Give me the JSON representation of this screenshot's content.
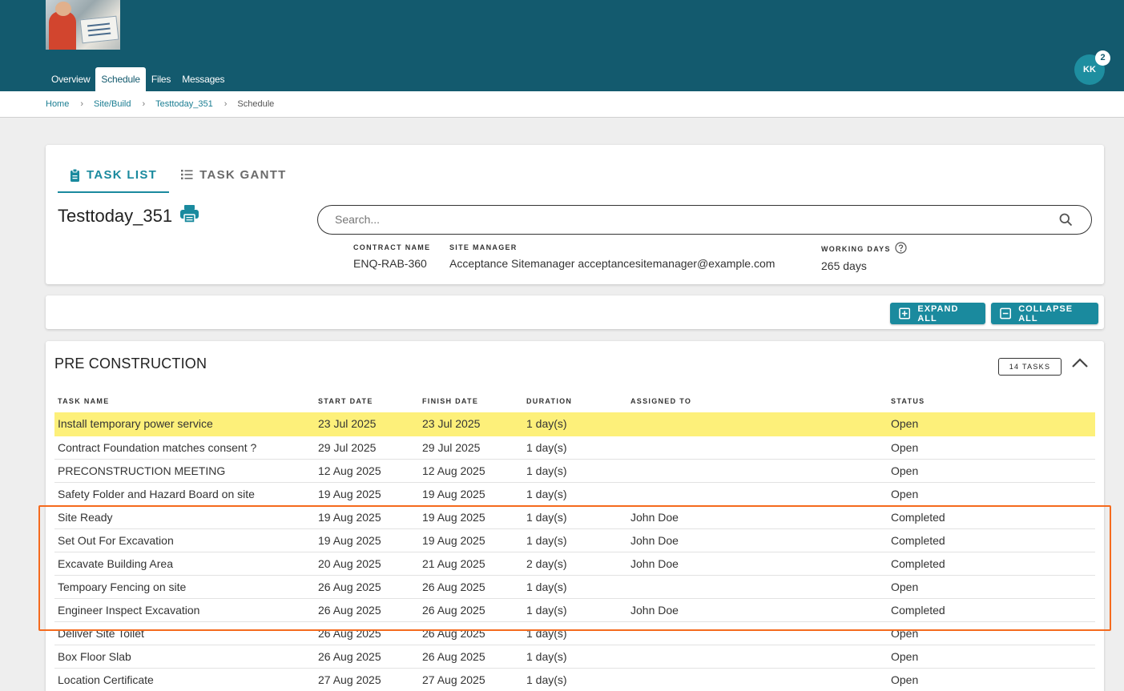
{
  "nav": {
    "items": [
      {
        "label": "Overview",
        "active": false
      },
      {
        "label": "Schedule",
        "active": true
      },
      {
        "label": "Files",
        "active": false
      },
      {
        "label": "Messages",
        "active": false
      }
    ]
  },
  "user": {
    "initials": "KK",
    "notification_count": "2"
  },
  "breadcrumb": {
    "items": [
      "Home",
      "Site/Build",
      "Testtoday_351",
      "Schedule"
    ],
    "separator": "›"
  },
  "tabs": [
    {
      "label": "TASK LIST",
      "icon": "clipboard-icon",
      "active": true
    },
    {
      "label": "TASK GANTT",
      "icon": "list-icon",
      "active": false
    }
  ],
  "project": {
    "title": "Testtoday_351"
  },
  "search": {
    "placeholder": "Search...",
    "value": ""
  },
  "meta": {
    "contract_label": "CONTRACT NAME",
    "contract_value": "ENQ-RAB-360",
    "manager_label": "SITE MANAGER",
    "manager_value": "Acceptance Sitemanager acceptancesitemanager@example.com",
    "days_label": "WORKING DAYS",
    "days_value": "265 days"
  },
  "actions": {
    "expand_all": "EXPAND ALL",
    "collapse_all": "COLLAPSE ALL"
  },
  "section": {
    "title": "PRE CONSTRUCTION",
    "tasks_badge": "14 TASKS",
    "columns": [
      "TASK NAME",
      "START DATE",
      "FINISH DATE",
      "DURATION",
      "ASSIGNED TO",
      "STATUS"
    ],
    "rows": [
      {
        "name": "Install temporary power service",
        "start": "23 Jul 2025",
        "finish": "23 Jul 2025",
        "duration": "1 day(s)",
        "assigned": "",
        "status": "Open"
      },
      {
        "name": "Contract Foundation matches consent ?",
        "start": "29 Jul 2025",
        "finish": "29 Jul 2025",
        "duration": "1 day(s)",
        "assigned": "",
        "status": "Open"
      },
      {
        "name": "PRECONSTRUCTION MEETING",
        "start": "12 Aug 2025",
        "finish": "12 Aug 2025",
        "duration": "1 day(s)",
        "assigned": "",
        "status": "Open"
      },
      {
        "name": "Safety Folder and Hazard Board on site",
        "start": "19 Aug 2025",
        "finish": "19 Aug 2025",
        "duration": "1 day(s)",
        "assigned": "",
        "status": "Open"
      },
      {
        "name": "Site Ready",
        "start": "19 Aug 2025",
        "finish": "19 Aug 2025",
        "duration": "1 day(s)",
        "assigned": "John Doe",
        "status": "Completed"
      },
      {
        "name": "Set Out For Excavation",
        "start": "19 Aug 2025",
        "finish": "19 Aug 2025",
        "duration": "1 day(s)",
        "assigned": "John Doe",
        "status": "Completed"
      },
      {
        "name": "Excavate Building Area",
        "start": "20 Aug 2025",
        "finish": "21 Aug 2025",
        "duration": "2 day(s)",
        "assigned": "John Doe",
        "status": "Completed"
      },
      {
        "name": "Tempoary Fencing on site",
        "start": "26 Aug 2025",
        "finish": "26 Aug 2025",
        "duration": "1 day(s)",
        "assigned": "",
        "status": "Open"
      },
      {
        "name": "Engineer Inspect Excavation",
        "start": "26 Aug 2025",
        "finish": "26 Aug 2025",
        "duration": "1 day(s)",
        "assigned": "John Doe",
        "status": "Completed"
      },
      {
        "name": "Deliver Site Toilet",
        "start": "26 Aug 2025",
        "finish": "26 Aug 2025",
        "duration": "1 day(s)",
        "assigned": "",
        "status": "Open"
      },
      {
        "name": "Box Floor Slab",
        "start": "26 Aug 2025",
        "finish": "26 Aug 2025",
        "duration": "1 day(s)",
        "assigned": "",
        "status": "Open"
      },
      {
        "name": "Location Certificate",
        "start": "27 Aug 2025",
        "finish": "27 Aug 2025",
        "duration": "1 day(s)",
        "assigned": "",
        "status": "Open"
      }
    ]
  },
  "colors": {
    "header": "#135a6e",
    "accent": "#1a8a9e",
    "highlight_row": "#fdf07a",
    "annotation_box": "#f56a1d"
  }
}
